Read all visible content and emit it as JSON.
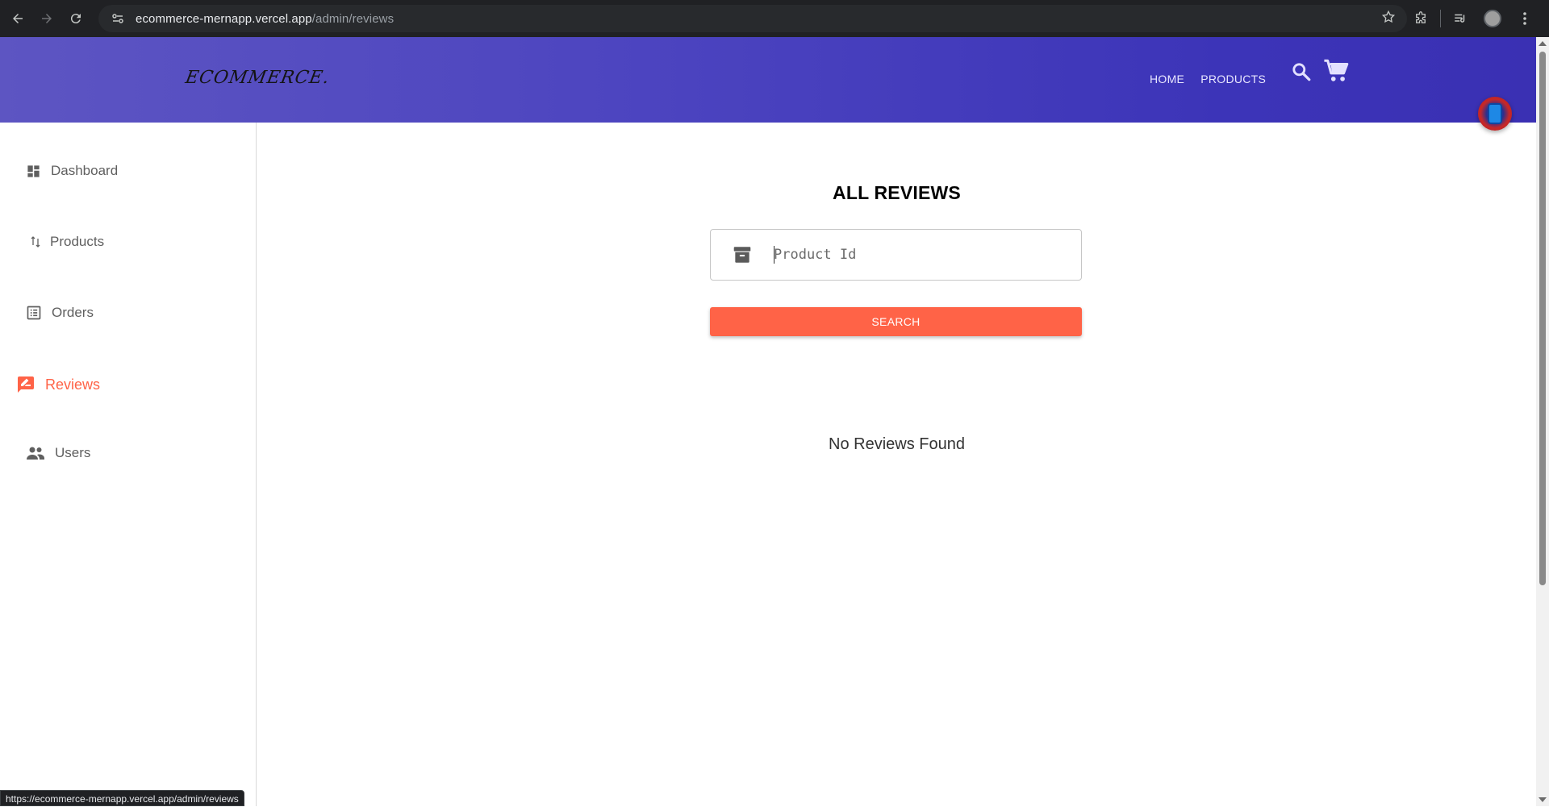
{
  "browser": {
    "url_host": "ecommerce-mernapp.vercel.app",
    "url_path": "/admin/reviews",
    "status_url": "https://ecommerce-mernapp.vercel.app/admin/reviews"
  },
  "header": {
    "logo": "ECOMMERCE.",
    "nav": [
      {
        "label": "HOME"
      },
      {
        "label": "PRODUCTS"
      }
    ]
  },
  "sidebar": {
    "items": [
      {
        "label": "Dashboard",
        "icon": "dashboard-icon"
      },
      {
        "label": "Products",
        "icon": "sort-arrows-icon"
      },
      {
        "label": "Orders",
        "icon": "list-alt-icon"
      },
      {
        "label": "Reviews",
        "icon": "rate-review-icon",
        "active": true
      },
      {
        "label": "Users",
        "icon": "people-icon"
      }
    ]
  },
  "main": {
    "title": "ALL REVIEWS",
    "product_id_placeholder": "Product Id",
    "search_label": "SEARCH",
    "empty_message": "No Reviews Found"
  },
  "colors": {
    "accent": "#ff6347",
    "header_start": "#5d55c2",
    "header_end": "#3a30b3"
  }
}
